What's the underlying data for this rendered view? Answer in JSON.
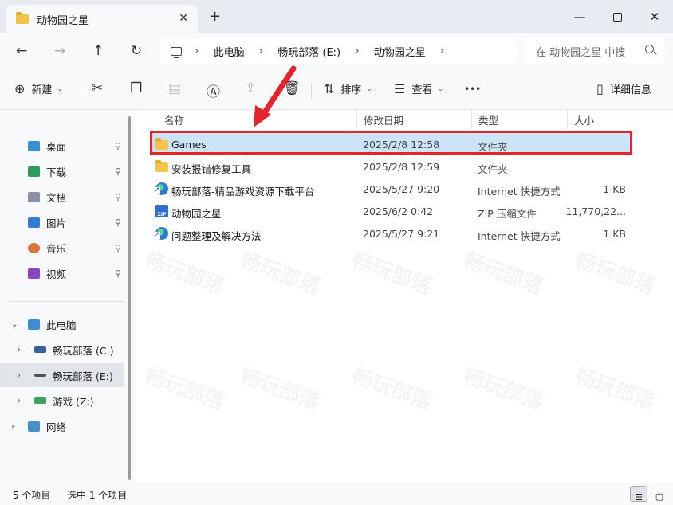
{
  "window": {
    "tab_title": "动物园之星",
    "close_glyph": "✕",
    "new_tab_glyph": "+",
    "minimize_glyph": "—",
    "close_window_glyph": "✕"
  },
  "nav": {
    "back_glyph": "←",
    "forward_glyph": "→",
    "up_glyph": "↑",
    "refresh_glyph": "↻",
    "breadcrumbs": [
      "此电脑",
      "畅玩部落 (E:)",
      "动物园之星"
    ],
    "sep_glyph": "›",
    "search_placeholder": "在 动物园之星 中搜"
  },
  "toolbar": {
    "new_label": "新建",
    "sort_label": "排序",
    "view_label": "查看",
    "more_glyph": "•••",
    "details_label": "详细信息"
  },
  "sidebar": {
    "quick_access": [
      {
        "label": "桌面",
        "color": "#3a8fd8"
      },
      {
        "label": "下载",
        "color": "#2a9c5c"
      },
      {
        "label": "文档",
        "color": "#8a94a6"
      },
      {
        "label": "图片",
        "color": "#2f7fd8"
      },
      {
        "label": "音乐",
        "color": "#e0733c"
      },
      {
        "label": "视频",
        "color": "#8b44c7"
      }
    ],
    "pin_glyph": "📌",
    "this_pc": "此电脑",
    "drives": [
      {
        "label": "畅玩部落 (C:)"
      },
      {
        "label": "畅玩部落 (E:)"
      },
      {
        "label": "游戏 (Z:)"
      }
    ],
    "network": "网络"
  },
  "columns": {
    "name": "名称",
    "date": "修改日期",
    "type": "类型",
    "size": "大小"
  },
  "files": [
    {
      "name": "Games",
      "date": "2025/2/8 12:58",
      "type": "文件夹",
      "size": "",
      "icon": "folder-icon"
    },
    {
      "name": "安装报错修复工具",
      "date": "2025/2/8 12:59",
      "type": "文件夹",
      "size": "",
      "icon": "folder-icon"
    },
    {
      "name": "畅玩部落-精品游戏资源下载平台",
      "date": "2025/5/27 9:20",
      "type": "Internet 快捷方式",
      "size": "1 KB",
      "icon": "internet-shortcut-icon"
    },
    {
      "name": "动物园之星",
      "date": "2025/6/2 0:42",
      "type": "ZIP 压缩文件",
      "size": "11,770,22...",
      "icon": "zip-icon"
    },
    {
      "name": "问题整理及解决方法",
      "date": "2025/5/27 9:21",
      "type": "Internet 快捷方式",
      "size": "1 KB",
      "icon": "internet-shortcut-icon"
    }
  ],
  "status": {
    "item_count": "5 个项目",
    "selected": "选中 1 个项目"
  },
  "watermark": "畅玩部落",
  "colors": {
    "selection": "#cce4f7",
    "highlight_border": "#e5232a",
    "arrow": "#e5232a"
  }
}
